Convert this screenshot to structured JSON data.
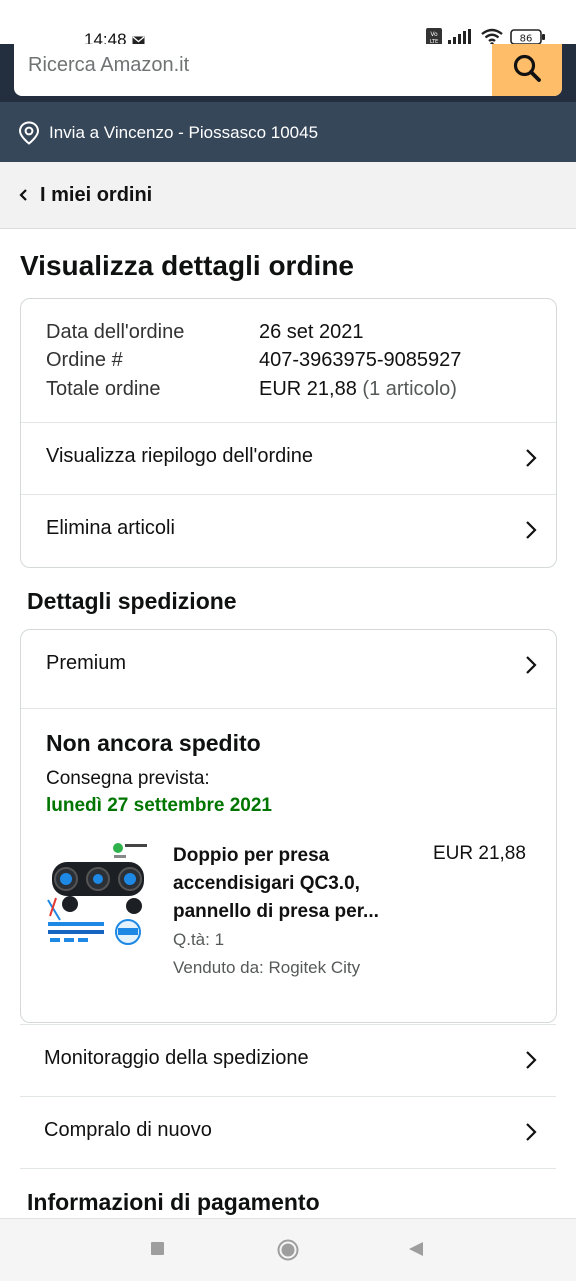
{
  "status": {
    "time": "14:48",
    "battery": "86"
  },
  "search": {
    "placeholder": "Ricerca Amazon.it"
  },
  "deliver": {
    "text": "Invia a Vincenzo - Piossasco 10045"
  },
  "breadcrumb": {
    "label": "I miei ordini"
  },
  "page": {
    "title": "Visualizza dettagli ordine"
  },
  "order": {
    "date_label": "Data dell'ordine",
    "date_value": "26 set 2021",
    "number_label": "Ordine #",
    "number_value": "407-3963975-9085927",
    "total_label": "Totale ordine",
    "total_value": "EUR 21,88",
    "total_items": "(1 articolo)",
    "summary_link": "Visualizza riepilogo dell'ordine",
    "delete_link": "Elimina articoli"
  },
  "shipping": {
    "heading": "Dettagli spedizione",
    "method": "Premium",
    "status": "Non ancora spedito",
    "delivery_label": "Consegna prevista:",
    "delivery_date": "lunedì 27 settembre 2021",
    "product": {
      "title": "Doppio per presa accendisigari QC3.0, pannello di presa per...",
      "price": "EUR 21,88",
      "qty": "Q.tà: 1",
      "seller": "Venduto da: Rogitek City"
    }
  },
  "actions": {
    "track": "Monitoraggio della spedizione",
    "buy_again": "Compralo di nuovo"
  },
  "payment": {
    "heading": "Informazioni di pagamento"
  },
  "colors": {
    "header": "#232f3e",
    "deliver_bar": "#37475a",
    "search_button": "#febd69",
    "delivery_green": "#007600"
  }
}
